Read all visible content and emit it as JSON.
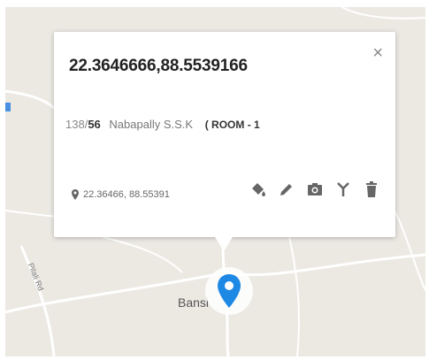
{
  "map": {
    "place_label": "Bansi",
    "road_label": "Pilali Rd"
  },
  "popup": {
    "title": "22.3646666,88.5539166",
    "code_a": "138/",
    "code_b": "56",
    "name": "Nabapally S.S.K",
    "room": "( ROOM - 1",
    "latlng": "22.36466, 88.55391",
    "close_symbol": "×"
  },
  "icons": {
    "location": "map-pin-icon",
    "fill": "paint-bucket-icon",
    "edit": "pencil-icon",
    "camera": "camera-icon",
    "branch": "fork-icon",
    "delete": "trash-icon",
    "marker": "location-marker-icon"
  },
  "colors": {
    "marker": "#1e88e5",
    "icon": "#666666",
    "map_bg": "#ece9e3",
    "road": "#ffffff"
  }
}
